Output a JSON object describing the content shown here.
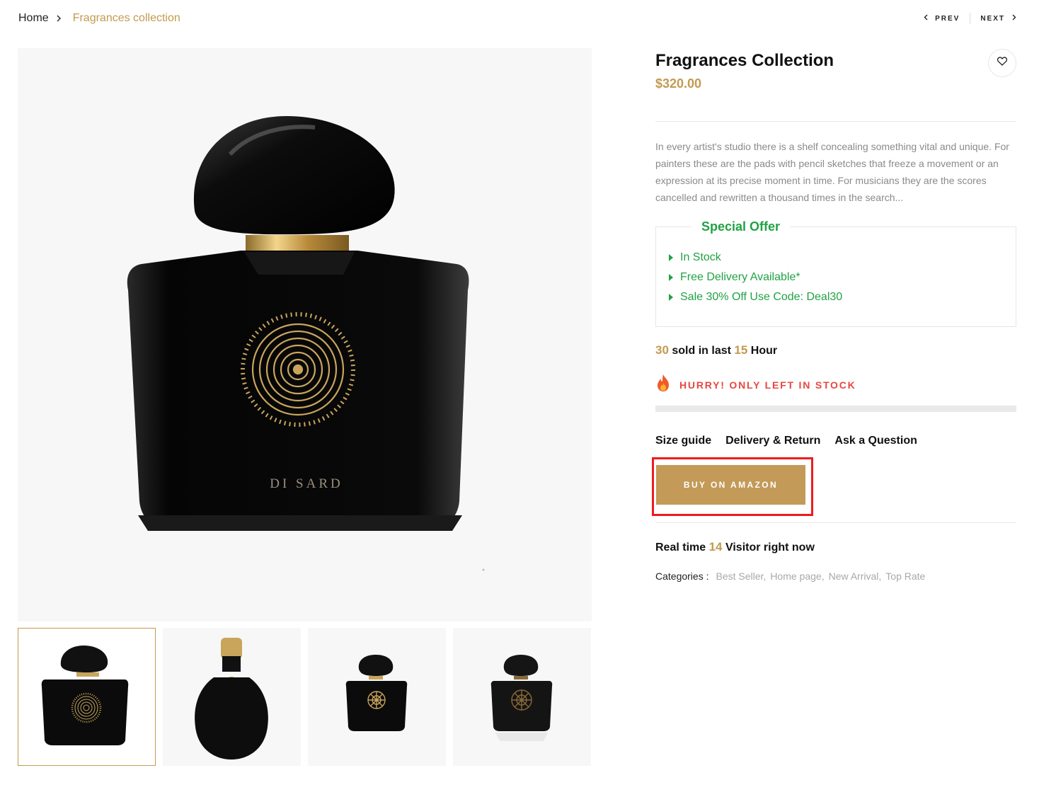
{
  "breadcrumb": {
    "home": "Home",
    "current": "Fragrances collection"
  },
  "pager": {
    "prev": "PREV",
    "next": "NEXT"
  },
  "gallery": {
    "main_image_label": "DI SARD",
    "thumbnail_count": 4,
    "active_thumbnail": 1
  },
  "product": {
    "title": "Fragrances Collection",
    "price": "$320.00",
    "description": "In every artist's studio there is a shelf concealing something vital and unique. For painters these are the pads with pencil sketches that freeze a movement or an expression at its precise moment in time. For musicians they are the scores cancelled and rewritten a thousand times in the search...",
    "wishlist_icon": "heart-icon"
  },
  "special_offer": {
    "title": "Special Offer",
    "items": [
      "In Stock",
      "Free Delivery Available*",
      "Sale 30% Off Use Code: Deal30"
    ],
    "color": "#21a244"
  },
  "sold": {
    "count": "30",
    "text_a": " sold in last ",
    "hours": "15",
    "text_b": " Hour"
  },
  "hurry": {
    "icon": "fire-icon",
    "text": "HURRY! ONLY LEFT IN STOCK"
  },
  "links": {
    "size_guide": "Size guide",
    "delivery": "Delivery & Return",
    "ask": "Ask a Question"
  },
  "buy_button": {
    "label": "BUY ON AMAZON",
    "color": "#c39a58"
  },
  "visitors": {
    "text_a": "Real time ",
    "count": "14",
    "text_b": " Visitor right now"
  },
  "categories": {
    "label": "Categories :",
    "items": [
      "Best Seller,",
      "Home page,",
      "New Arrival,",
      "Top Rate"
    ]
  },
  "colors": {
    "accent": "#c39a4f",
    "alert": "#e8473f",
    "highlight_frame": "#ee1c1c"
  }
}
